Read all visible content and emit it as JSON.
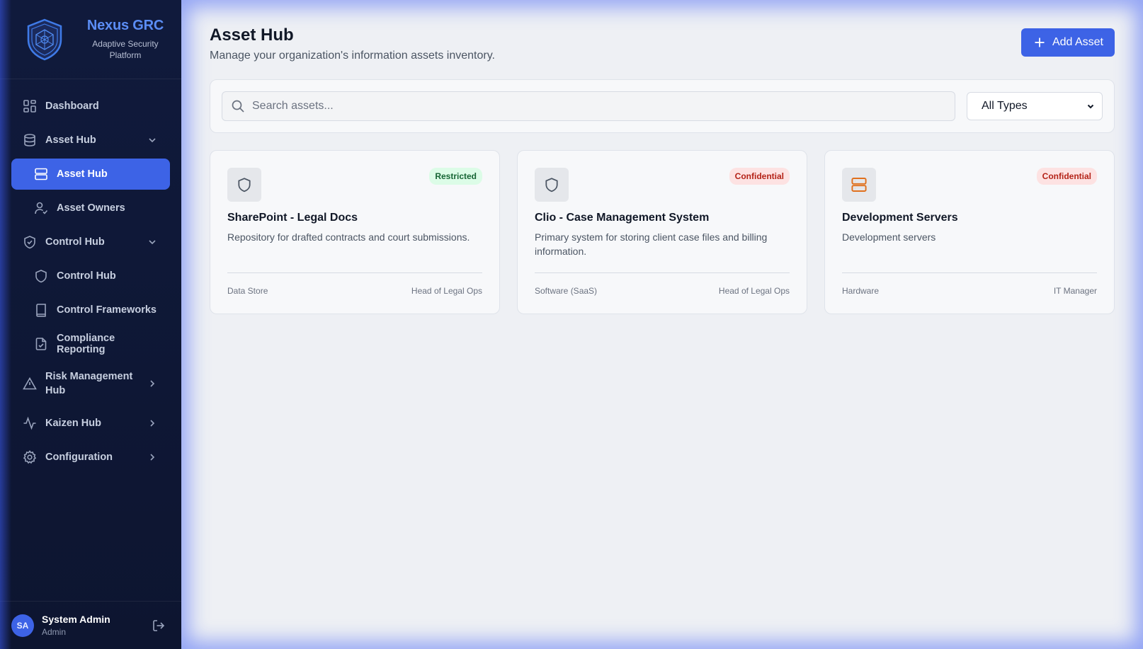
{
  "brand": {
    "title": "Nexus GRC",
    "subtitle": "Adaptive Security Platform"
  },
  "nav": {
    "items": [
      {
        "label": "Dashboard",
        "icon": "dashboard-icon"
      },
      {
        "label": "Asset Hub",
        "icon": "database-icon",
        "expanded": true
      },
      {
        "label": "Asset Hub",
        "icon": "server-icon",
        "active": true
      },
      {
        "label": "Asset Owners",
        "icon": "user-check-icon"
      },
      {
        "label": "Control Hub",
        "icon": "shield-check-icon",
        "expanded": true
      },
      {
        "label": "Control Hub",
        "icon": "shield-icon"
      },
      {
        "label": "Control Frameworks",
        "icon": "book-icon"
      },
      {
        "label": "Compliance Reporting",
        "icon": "file-check-icon"
      },
      {
        "label": "Risk Management Hub",
        "icon": "alert-triangle-icon",
        "expanded": false
      },
      {
        "label": "Kaizen Hub",
        "icon": "activity-icon",
        "expanded": false
      },
      {
        "label": "Configuration",
        "icon": "gear-icon",
        "expanded": false
      }
    ]
  },
  "user": {
    "initials": "SA",
    "name": "System Admin",
    "role": "Admin"
  },
  "page": {
    "title": "Asset Hub",
    "subtitle": "Manage your organization's information assets inventory.",
    "add_button": "Add Asset"
  },
  "filters": {
    "search_placeholder": "Search assets...",
    "type_selected": "All Types"
  },
  "assets": [
    {
      "title": "SharePoint - Legal Docs",
      "description": "Repository for drafted contracts and court submissions.",
      "classification": "Restricted",
      "type": "Data Store",
      "owner": "Head of Legal Ops",
      "icon": "shield-icon"
    },
    {
      "title": "Clio - Case Management System",
      "description": "Primary system for storing client case files and billing information.",
      "classification": "Confidential",
      "type": "Software (SaaS)",
      "owner": "Head of Legal Ops",
      "icon": "shield-icon"
    },
    {
      "title": "Development Servers",
      "description": "Development servers",
      "classification": "Confidential",
      "type": "Hardware",
      "owner": "IT Manager",
      "icon": "server-icon"
    }
  ],
  "colors": {
    "accent": "#3d63e6",
    "brand_title": "#5b8df5",
    "sidebar_bg": "#101a3c",
    "restricted_badge": "#dcfce7",
    "confidential_badge": "#fde2e2",
    "server_icon": "#e0701d"
  }
}
